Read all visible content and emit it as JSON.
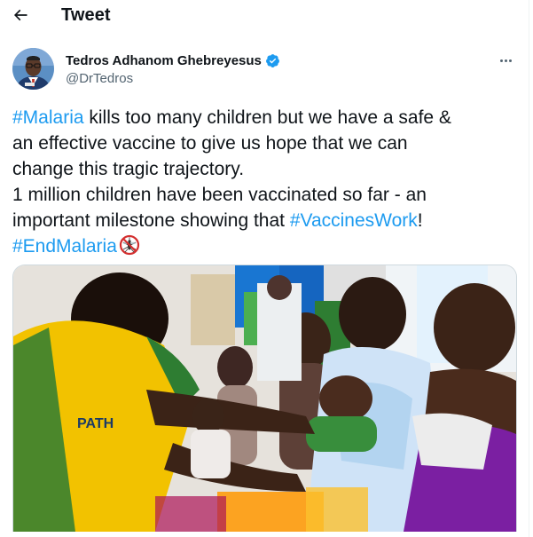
{
  "header": {
    "title": "Tweet"
  },
  "author": {
    "name": "Tedros Adhanom Ghebreyesus",
    "handle": "@DrTedros"
  },
  "tweet": {
    "line1_tag": "#Malaria",
    "line1_text": " kills too many children but we have a safe &",
    "line2_text": "an effective vaccine to give us hope that we can",
    "line3_text": "change this tragic trajectory.",
    "line4_text": "1 million children have been vaccinated so far - an",
    "line5_text": "important milestone showing that ",
    "line5_tag": "#VaccinesWork",
    "line5_end": "!",
    "line6_tag": "#EndMalaria"
  },
  "media": {
    "shirt_text": "PATH"
  },
  "colors": {
    "accent": "#1d9bf0",
    "text": "#0f1419",
    "muted": "#536471"
  },
  "icons": [
    "back-arrow-icon",
    "verified-badge-icon",
    "more-dots-icon",
    "no-mosquito-icon"
  ]
}
